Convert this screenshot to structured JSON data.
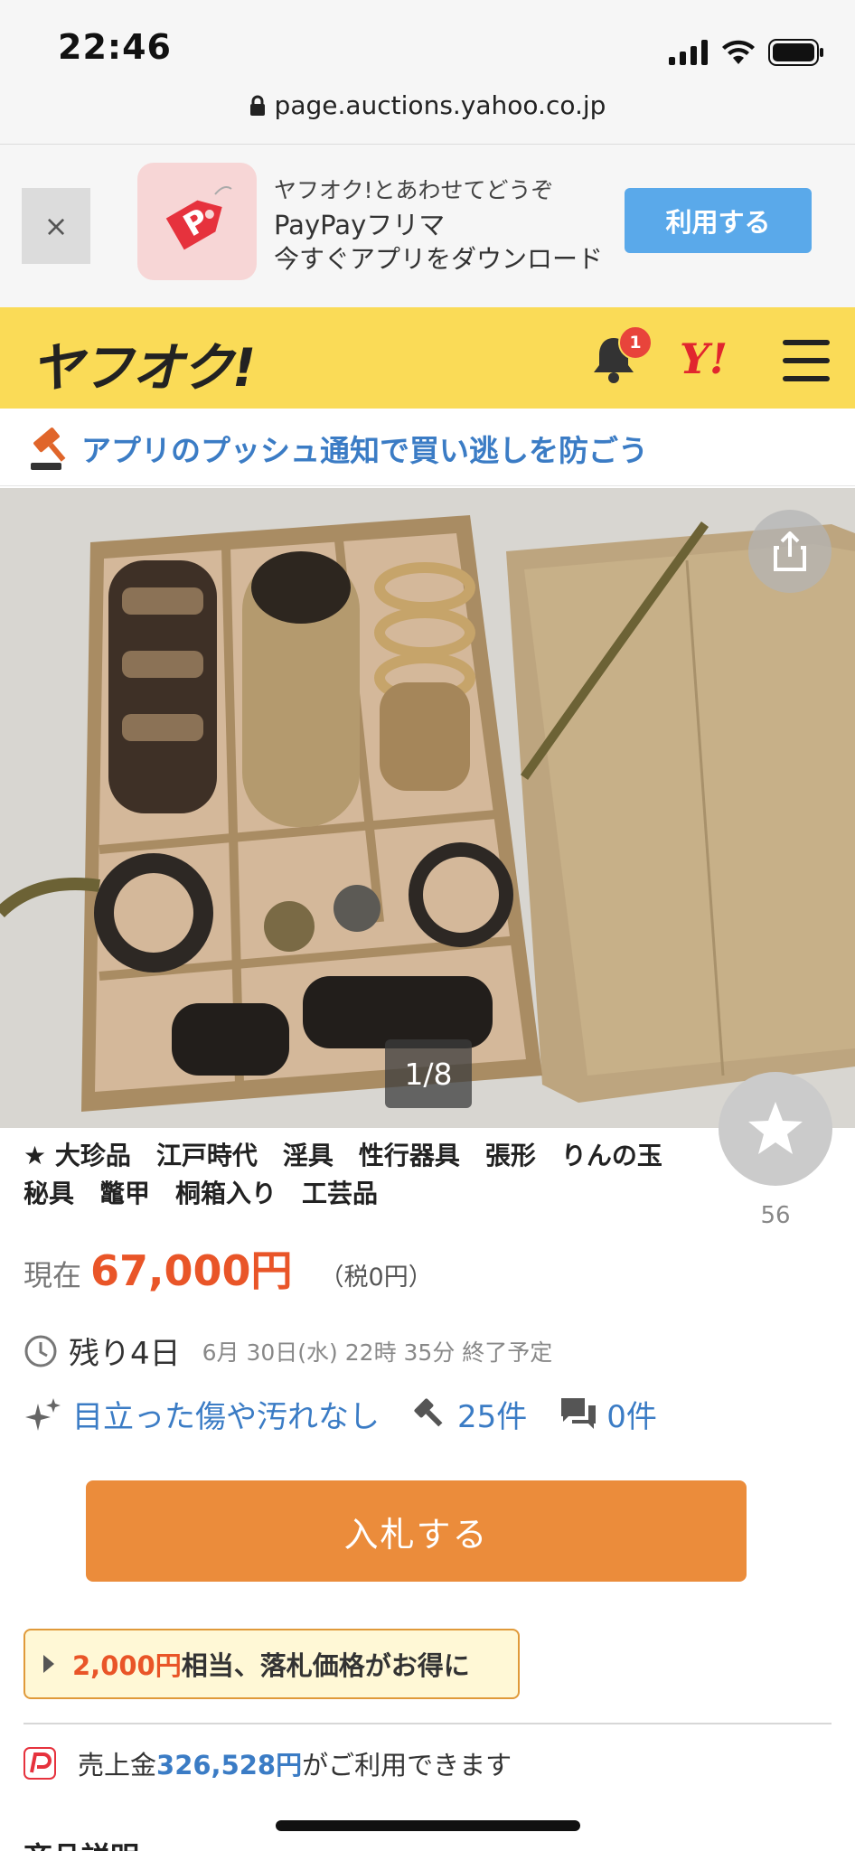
{
  "status_bar": {
    "time": "22:46"
  },
  "browser": {
    "url": "page.auctions.yahoo.co.jp"
  },
  "app_banner": {
    "close": "×",
    "line1": "ヤフオク!とあわせてどうぞ",
    "line2": "PayPayフリマ",
    "line3": "今すぐアプリをダウンロード",
    "button": "利用する"
  },
  "header": {
    "logo": "ヤフオク!",
    "notification_count": "1",
    "yahoo_logo": "Y!"
  },
  "push_notice": {
    "text": "アプリのプッシュ通知で買い逃しを防ごう"
  },
  "gallery": {
    "counter": "1/8",
    "favorite_count": "56"
  },
  "item": {
    "title": "★ 大珍品　江戸時代　淫具　性行器具　張形　りんの玉　秘具　鼈甲　桐箱入り　工芸品",
    "price_label": "現在",
    "price": "67,000円",
    "tax": "（税0円）",
    "remaining": "残り4日",
    "end_time": "6月 30日(水) 22時 35分 終了予定",
    "condition": "目立った傷や汚れなし",
    "bids": "25件",
    "comments": "0件"
  },
  "bid_button": "入札する",
  "promo": {
    "amount": "2,000円",
    "text": "相当、落札価格がお得に"
  },
  "paypay": {
    "prefix": "売上金",
    "balance": "326,528円",
    "suffix": "がご利用できます"
  },
  "next_section": "商品説明",
  "colors": {
    "header_yellow": "#fadb57",
    "price_red": "#e95528",
    "link_blue": "#3b7cc5",
    "bid_orange": "#eb8c3b"
  }
}
